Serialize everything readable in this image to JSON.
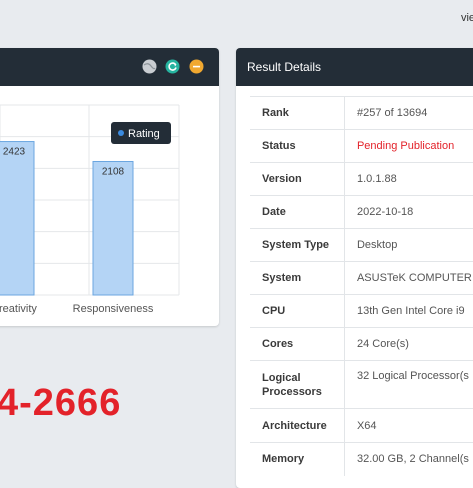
{
  "top_right_text": "vie",
  "left_panel": {
    "header_icons": [
      "globe-icon",
      "refresh-icon",
      "minus-icon"
    ],
    "chart_data": {
      "type": "bar",
      "categories": [
        "Creativity",
        "Responsiveness"
      ],
      "series": [
        {
          "name": "Rating",
          "values": [
            2423,
            2108
          ]
        }
      ],
      "ylim": [
        0,
        3000
      ],
      "grid": true,
      "legend": "top-right",
      "bar_color": "#b4d4f5",
      "bar_border_color": "#6ba6e0",
      "legend_dot_color": "#3b8be0"
    }
  },
  "phone_text": "4-2666",
  "result_details": {
    "title": "Result Details",
    "rows": [
      {
        "label": "Rank",
        "value": "#257 of 13694"
      },
      {
        "label": "Status",
        "value": "Pending Publication",
        "status": "pending"
      },
      {
        "label": "Version",
        "value": "1.0.1.88"
      },
      {
        "label": "Date",
        "value": "2022-10-18"
      },
      {
        "label": "System Type",
        "value": "Desktop"
      },
      {
        "label": "System",
        "value": "ASUSTeK COMPUTER I"
      },
      {
        "label": "CPU",
        "value": "13th Gen Intel Core i9"
      },
      {
        "label": "Cores",
        "value": "24 Core(s)"
      },
      {
        "label": "Logical Processors",
        "value": "32 Logical Processor(s"
      },
      {
        "label": "Architecture",
        "value": "X64"
      },
      {
        "label": "Memory",
        "value": "32.00 GB, 2 Channel(s"
      }
    ]
  },
  "colors": {
    "header_bg": "#232d37",
    "accent_red": "#e3222a",
    "page_bg": "#e8ebef"
  }
}
